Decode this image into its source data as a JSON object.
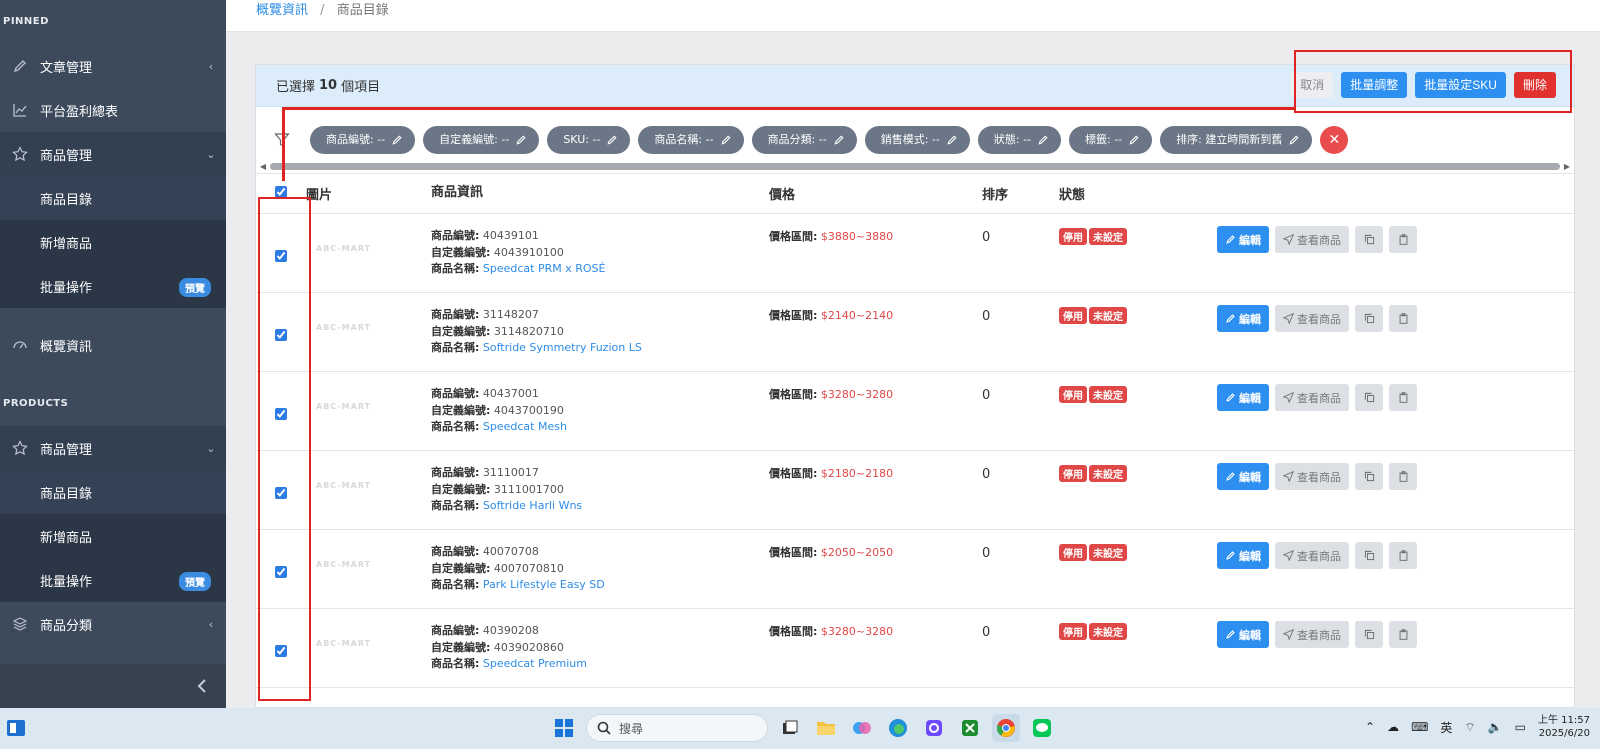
{
  "sidebar": {
    "pinned_title": "PINNED",
    "pinned": [
      {
        "label": "文章管理",
        "icon": "pencil-icon",
        "chevron": "‹"
      },
      {
        "label": "平台盈利總表",
        "icon": "chart-icon"
      },
      {
        "label": "商品管理",
        "icon": "star-icon",
        "chevron": "⌄"
      }
    ],
    "pinned_sub": [
      {
        "label": "商品目錄"
      },
      {
        "label": "新增商品"
      },
      {
        "label": "批量操作",
        "badge": "預覽"
      }
    ],
    "overview": {
      "label": "概覽資訊",
      "icon": "dashboard-icon"
    },
    "products_title": "PRODUCTS",
    "products_main": {
      "label": "商品管理",
      "icon": "star-icon",
      "chevron": "⌄"
    },
    "products_sub": [
      {
        "label": "商品目錄"
      },
      {
        "label": "新增商品"
      },
      {
        "label": "批量操作",
        "badge": "預覽"
      }
    ],
    "category": {
      "label": "商品分類",
      "icon": "layers-icon",
      "chevron": "‹"
    },
    "collapse_icon": "chevron-left-icon"
  },
  "breadcrumb": {
    "parent": "概覽資訊",
    "separator": "/",
    "current": "商品目錄"
  },
  "selection": {
    "prefix": "已選擇",
    "count": "10",
    "suffix": "個項目",
    "cancel": "取消",
    "batch_adjust": "批量調整",
    "batch_sku": "批量設定SKU",
    "delete": "刪除"
  },
  "filters": [
    "商品編號: --",
    "自定義編號: --",
    "SKU: --",
    "商品名稱: --",
    "商品分類: --",
    "銷售模式: --",
    "狀態: --",
    "標籤: --",
    "排序: 建立時間新到舊"
  ],
  "table": {
    "headers": {
      "image": "圖片",
      "info": "商品資訊",
      "price": "價格",
      "order": "排序",
      "status": "狀態"
    },
    "labels": {
      "code": "商品編號:",
      "custom": "自定義編號:",
      "name": "商品名稱:",
      "price_range": "價格區間:",
      "thumb": "ABC-MART",
      "tag_off": "停用",
      "tag_unset": "未設定",
      "edit": "編輯",
      "view": "查看商品"
    },
    "rows": [
      {
        "code": "40439101",
        "custom": "4043910100",
        "name": "Speedcat PRM x ROSÉ",
        "price": "$3880~3880",
        "order": "0"
      },
      {
        "code": "31148207",
        "custom": "3114820710",
        "name": "Softride Symmetry Fuzion LS",
        "price": "$2140~2140",
        "order": "0"
      },
      {
        "code": "40437001",
        "custom": "4043700190",
        "name": "Speedcat Mesh",
        "price": "$3280~3280",
        "order": "0"
      },
      {
        "code": "31110017",
        "custom": "3111001700",
        "name": "Softride Harli Wns",
        "price": "$2180~2180",
        "order": "0"
      },
      {
        "code": "40070708",
        "custom": "4007070810",
        "name": "Park Lifestyle Easy SD",
        "price": "$2050~2050",
        "order": "0"
      },
      {
        "code": "40390208",
        "custom": "4039020860",
        "name": "Speedcat Premium",
        "price": "$3280~3280",
        "order": "0"
      }
    ]
  },
  "taskbar": {
    "search_placeholder": "搜尋",
    "ime": "英",
    "time": "上午 11:57",
    "date": "2025/6/20"
  },
  "colors": {
    "sidebar": "#3d4a5c",
    "primary": "#2d8ff0",
    "danger": "#e0312f",
    "highlight": "#e02424"
  }
}
